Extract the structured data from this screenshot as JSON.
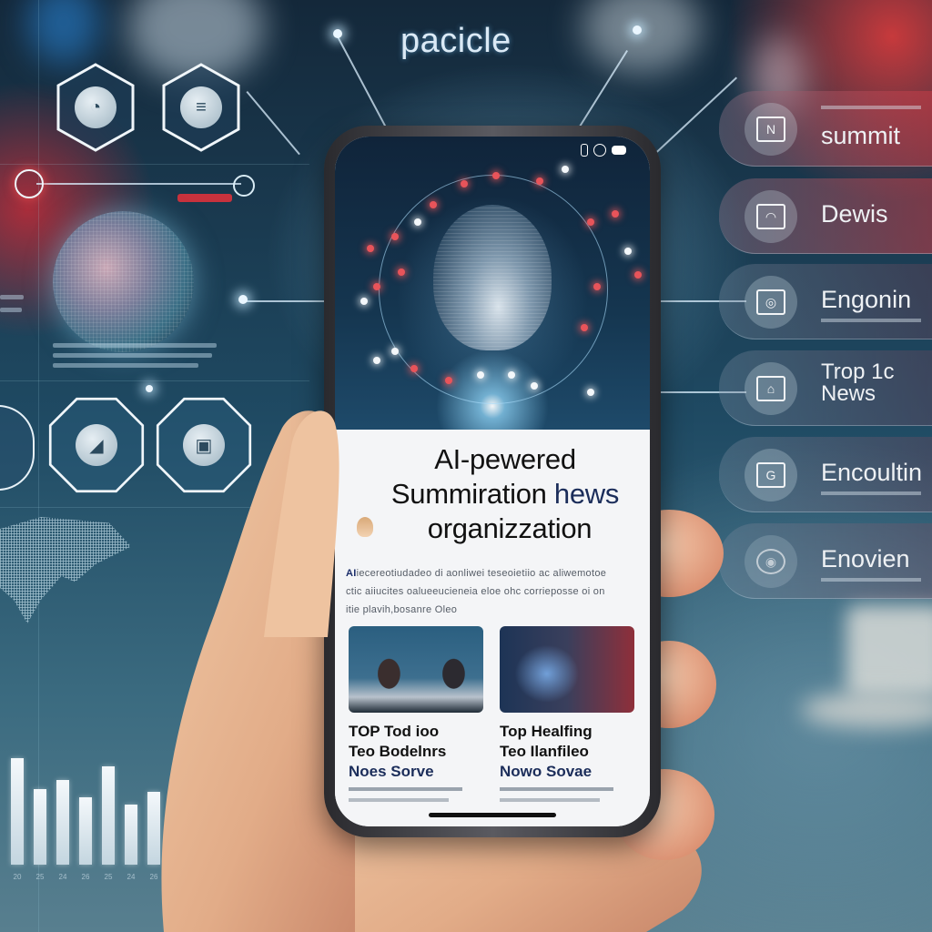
{
  "background": {
    "brand_text": "pacicle",
    "hexagon_icons_top": [
      "gauge-icon",
      "card-icon"
    ],
    "hexagon_icons_mid": [
      "chart-icon",
      "folder-icon"
    ],
    "bar_chart": {
      "values": [
        0.78,
        0.55,
        0.62,
        0.49,
        0.72,
        0.44,
        0.53
      ],
      "labels": [
        "20",
        "25",
        "24",
        "26",
        "25",
        "24",
        "26"
      ]
    }
  },
  "side_menu": {
    "items": [
      {
        "icon": "news-icon",
        "label": "summit",
        "variant": "red"
      },
      {
        "icon": "camera-icon",
        "label": "Dewis",
        "variant": "red"
      },
      {
        "icon": "settings-icon",
        "label": "Engonin",
        "variant": "plain"
      },
      {
        "icon": "document-icon",
        "label": "Trop  1c",
        "label2": "News",
        "variant": "plain"
      },
      {
        "icon": "broadcast-icon",
        "label": "Encoultin",
        "variant": "plain"
      },
      {
        "icon": "globe-icon",
        "label": "Enovien",
        "variant": "plain"
      }
    ]
  },
  "phone": {
    "status_icons": [
      "signal-icon",
      "alarm-icon",
      "battery-icon"
    ],
    "headline": {
      "line1": "AI-pewered",
      "line2_main": "Summiration",
      "line2_accent": "hews",
      "line3": "organizzation"
    },
    "summary": {
      "lead": "AI",
      "text": "iecereotiudadeo di aonliwei teseoietiio ac aliwemotoe ctic aiiucites oalueeucieneia eloe ohc corrieposse oi on itie plavih,bosanre Oleo"
    },
    "cards": [
      {
        "image": "news-anchors-thumbnail",
        "title_lines": [
          "TOP Tod ioo",
          "Teo Bodelnrs"
        ],
        "title_accent": "Noes Sorve"
      },
      {
        "image": "abstract-data-thumbnail",
        "title_lines": [
          "Top Healfing",
          "Teo Ilanfileo"
        ],
        "title_accent": "Nowo Sovae"
      }
    ]
  }
}
